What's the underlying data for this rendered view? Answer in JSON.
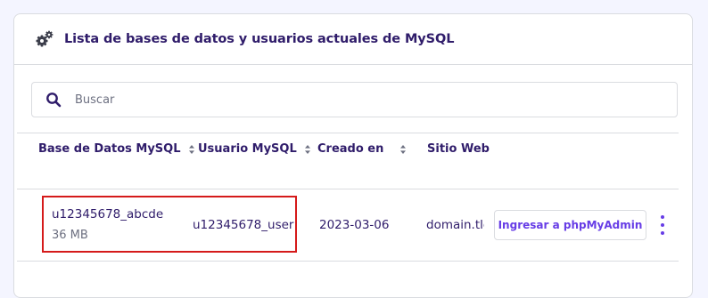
{
  "card": {
    "title": "Lista de bases de datos y usuarios actuales de MySQL",
    "title_icon": "gears-icon"
  },
  "search": {
    "placeholder": "Buscar",
    "value": "",
    "icon": "search-icon"
  },
  "table": {
    "columns": [
      {
        "label": "Base de Datos MySQL",
        "sortable": true
      },
      {
        "label": "Usuario MySQL",
        "sortable": true
      },
      {
        "label": "Creado en",
        "sortable": true
      },
      {
        "label": "Sitio Web",
        "sortable": false
      }
    ],
    "rows": [
      {
        "database": "u12345678_abcde",
        "size": "36 MB",
        "user": "u12345678_user",
        "created": "2023-03-06",
        "website": "domain.tld",
        "action_label": "Ingresar a phpMyAdmin",
        "more_icon": "kebab-menu-icon"
      }
    ]
  },
  "colors": {
    "text": "#2f1c6a",
    "accent": "#673de6",
    "highlight": "#d51a1a",
    "border": "#dadce0"
  }
}
